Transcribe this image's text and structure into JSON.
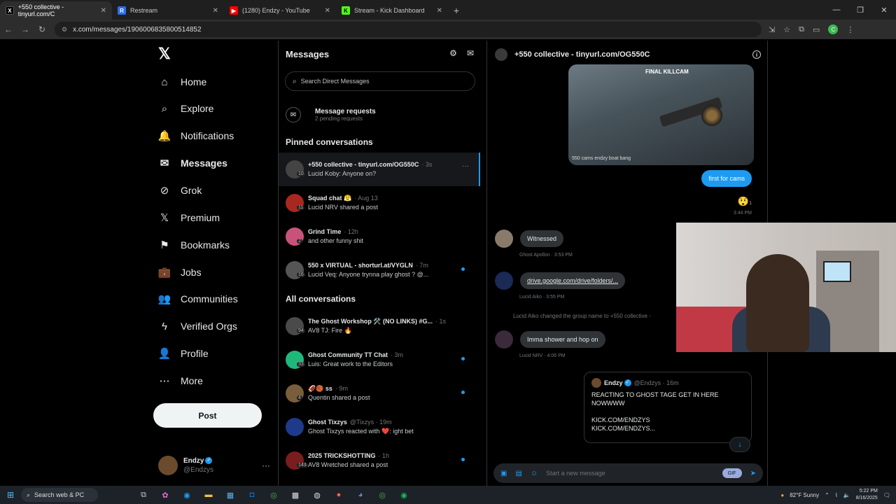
{
  "browser": {
    "tabs": [
      {
        "label": "+550 collective - tinyurl.com/C",
        "icon": "x-favicon",
        "color": "#000000",
        "active": true
      },
      {
        "label": "Restream",
        "icon": "restream-favicon",
        "color": "#2b6ef2",
        "active": false
      },
      {
        "label": "(1280) Endzy - YouTube",
        "icon": "youtube-favicon",
        "color": "#ff0000",
        "active": false
      },
      {
        "label": "Stream - Kick Dashboard",
        "icon": "kick-favicon",
        "color": "#53fc18",
        "active": false
      }
    ],
    "url": "x.com/messages/1906006835800514852"
  },
  "sidebar": {
    "items": [
      {
        "label": "Home",
        "icon": "home-icon",
        "glyph": "⌂"
      },
      {
        "label": "Explore",
        "icon": "search-icon",
        "glyph": "⌕"
      },
      {
        "label": "Notifications",
        "icon": "bell-icon",
        "glyph": "🔔"
      },
      {
        "label": "Messages",
        "icon": "mail-icon",
        "glyph": "✉"
      },
      {
        "label": "Grok",
        "icon": "grok-icon",
        "glyph": "⊘"
      },
      {
        "label": "Premium",
        "icon": "x-premium-icon",
        "glyph": "𝕏"
      },
      {
        "label": "Bookmarks",
        "icon": "bookmark-icon",
        "glyph": "⚑"
      },
      {
        "label": "Jobs",
        "icon": "briefcase-icon",
        "glyph": "💼"
      },
      {
        "label": "Communities",
        "icon": "people-icon",
        "glyph": "👥"
      },
      {
        "label": "Verified Orgs",
        "icon": "lightning-icon",
        "glyph": "ϟ"
      },
      {
        "label": "Profile",
        "icon": "person-icon",
        "glyph": "👤"
      },
      {
        "label": "More",
        "icon": "more-circle-icon",
        "glyph": "⋯"
      }
    ],
    "post_label": "Post",
    "account": {
      "name": "Endzy",
      "handle": "@Endzys"
    }
  },
  "messages": {
    "title": "Messages",
    "search_placeholder": "Search Direct Messages",
    "requests_title": "Message requests",
    "requests_sub": "2 pending requests",
    "pinned_title": "Pinned conversations",
    "all_title": "All conversations",
    "pinned": [
      {
        "name": "+550 collective - tinyurl.com/OG550C",
        "time": "· 3s",
        "preview": "Lucid Koby: Anyone on?",
        "count": "10",
        "avatar_color": "#444",
        "active": true,
        "unread": false
      },
      {
        "name": "Squad chat 😤",
        "time": "· Aug 13",
        "preview": "Lucid NRV shared a post",
        "count": "11",
        "avatar_color": "#a8281f",
        "active": false,
        "unread": false
      },
      {
        "name": "Grind Time",
        "time": "· 12h",
        "preview": "and other funny shit",
        "count": "2",
        "avatar_color": "#c9527a",
        "active": false,
        "unread": false
      },
      {
        "name": "550 x VIRTUAL - shorturl.at/VYGLN",
        "time": "· 7m",
        "preview": "Lucid Veq: Anyone trynna play ghost ? @...",
        "count": "16",
        "avatar_color": "#555",
        "active": false,
        "unread": true
      }
    ],
    "all": [
      {
        "name": "The Ghost Workshop 🛠️ (NO LINKS) #G...",
        "time": "· 1s",
        "preview": "AV8 TJ: Fire 🔥",
        "count": "94",
        "avatar_color": "#4a4a4a",
        "unread": false
      },
      {
        "name": "Ghost Community TT Chat",
        "time": "· 3m",
        "preview": "Luis: Great work to the Editors",
        "count": "33",
        "avatar_color": "#1fb87a",
        "unread": true
      },
      {
        "name": "🏈🏀 ss",
        "time": "· 9m",
        "preview": "Quentin shared a post",
        "count": "4",
        "avatar_color": "#7a5d3a",
        "unread": true
      },
      {
        "name": "Ghost Tixzys",
        "time": "@Tixzys · 19m",
        "preview": "Ghost Tixzys reacted with ❤️: ight bet",
        "count": "",
        "avatar_color": "#1e3a8a",
        "unread": false
      },
      {
        "name": "2025 TRICKSHOTTING",
        "time": "· 1h",
        "preview": "AV8 Wretched shared a post",
        "count": "143",
        "avatar_color": "#7a1d1d",
        "unread": true
      }
    ]
  },
  "chat": {
    "title": "+550 collective - tinyurl.com/OG550C",
    "killcam_title": "FINAL KILLCAM",
    "killcam_caption": "550 cams endzy boat bang",
    "outgoing_text": "first for cams",
    "outgoing_reaction": "😲",
    "outgoing_reaction_count": "1",
    "outgoing_time": "3:44 PM",
    "messages": [
      {
        "text": "Witnessed",
        "meta": "Ghost Apollon · 3:53 PM",
        "avatar_color": "#8a7a6a",
        "link": false
      },
      {
        "text": "drive.google.com/drive/folders/...",
        "meta": "Lucid Aiko · 3:55 PM",
        "avatar_color": "#1a2a55",
        "link": true
      },
      {
        "text": "Imma shower and hop on",
        "meta": "Lucid NRV · 4:06 PM",
        "avatar_color": "#3a2a3a",
        "link": false
      }
    ],
    "system_message": "Lucid Aiko changed the group name to +550 collective -",
    "quote": {
      "name": "Endzy",
      "handle": "@Endzys · 16m",
      "body": "REACTING TO GHOST TAGE GET IN HERE NOWWWW\n\nKICK.COM/ENDZYS\nKICK.COM/ENDZYS..."
    },
    "composer_placeholder": "Start a new message",
    "gif_label": "GIF"
  },
  "taskbar": {
    "search_label": "Search web & PC",
    "weather": "82°F  Sunny",
    "time": "5:22 PM",
    "date": "8/16/2025"
  }
}
